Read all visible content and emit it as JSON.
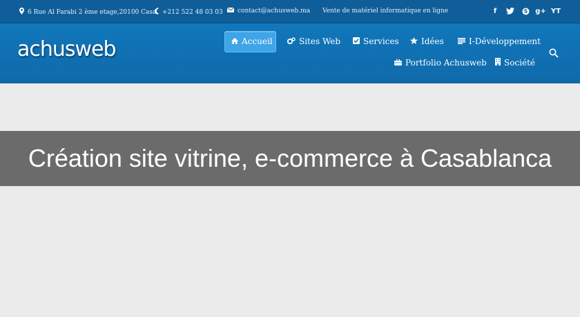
{
  "topbar": {
    "address": "6 Rue Al Farabi 2 ème etage,20100 Casa.",
    "phone": "+212 522 48 03 03",
    "email": "contact@achusweb.ma",
    "tagline": "Vente de matériel informatique en ligne",
    "social": [
      {
        "icon": "facebook-icon",
        "glyph": "f"
      },
      {
        "icon": "twitter-icon",
        "glyph": "t"
      },
      {
        "icon": "skype-icon",
        "glyph": "S"
      },
      {
        "icon": "google-plus-icon",
        "glyph": "g+"
      },
      {
        "icon": "yt-icon",
        "glyph": "YT"
      }
    ]
  },
  "header": {
    "logo": "achusweb",
    "nav": [
      {
        "label": "Accueil",
        "icon": "home-icon",
        "active": true
      },
      {
        "label": "Sites Web",
        "icon": "cogs-icon"
      },
      {
        "label": "Services",
        "icon": "checkbox-icon"
      },
      {
        "label": "Idées",
        "icon": "star-icon"
      },
      {
        "label": "I-Développement",
        "icon": "list-icon"
      },
      {
        "label": "Portfolio Achusweb",
        "icon": "briefcase-icon"
      },
      {
        "label": "Société",
        "icon": "building-icon"
      }
    ]
  },
  "banner": {
    "title": "Création site vitrine, e-commerce à Casablanca"
  },
  "colors": {
    "topbar": "#0f5e9a",
    "header": "#1177bb",
    "active_nav": "#3ea5e6",
    "banner": "#6b6b6b",
    "page_bg": "#ebebeb"
  }
}
